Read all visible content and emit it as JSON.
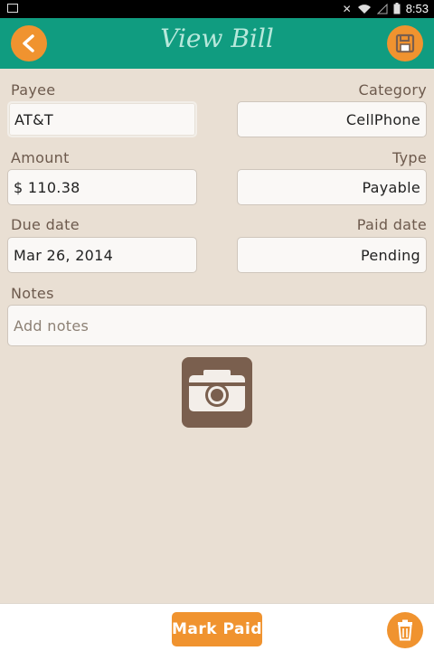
{
  "status_bar": {
    "time": "8:53"
  },
  "header": {
    "title": "View Bill",
    "back_icon": "back-arrow-icon",
    "save_icon": "save-floppy-icon"
  },
  "form": {
    "payee": {
      "label": "Payee",
      "value": "AT&T"
    },
    "category": {
      "label": "Category",
      "value": "CellPhone"
    },
    "amount": {
      "label": "Amount",
      "value": "$ 110.38"
    },
    "type": {
      "label": "Type",
      "value": "Payable"
    },
    "due_date": {
      "label": "Due date",
      "value": "Mar 26, 2014"
    },
    "paid_date": {
      "label": "Paid date",
      "value": "Pending"
    },
    "notes": {
      "label": "Notes",
      "placeholder": "Add notes"
    }
  },
  "footer": {
    "mark_paid_label": "Mark Paid",
    "trash_icon": "trash-icon"
  },
  "colors": {
    "header": "#109c80",
    "accent": "#f0932f",
    "background": "#e9dfd3",
    "label": "#6d5a4d",
    "camera": "#7a5f4e"
  }
}
